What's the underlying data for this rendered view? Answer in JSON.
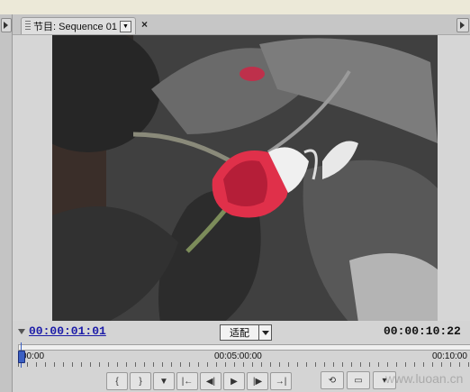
{
  "program_monitor": {
    "tab_title": "节目: Sequence 01",
    "current_timecode": "00:00:01:01",
    "fit_option": "适配",
    "duration_timecode": "00:00:10:22",
    "ruler_labels": [
      "00:00",
      "00:05:00:00",
      "00:10:00"
    ]
  },
  "transport": {
    "buttons": [
      "mark-in",
      "mark-out",
      "set-marker",
      "go-to-in",
      "step-back",
      "play",
      "step-forward",
      "go-to-out"
    ],
    "extra_buttons": [
      "loop",
      "safe-margins",
      "output"
    ]
  },
  "watermark": {
    "url": "www.luoan.cn"
  },
  "colors": {
    "timecode_blue": "#1c1ca8",
    "panel_gray": "#d4d4d4",
    "flower_red": "#e0304a"
  }
}
